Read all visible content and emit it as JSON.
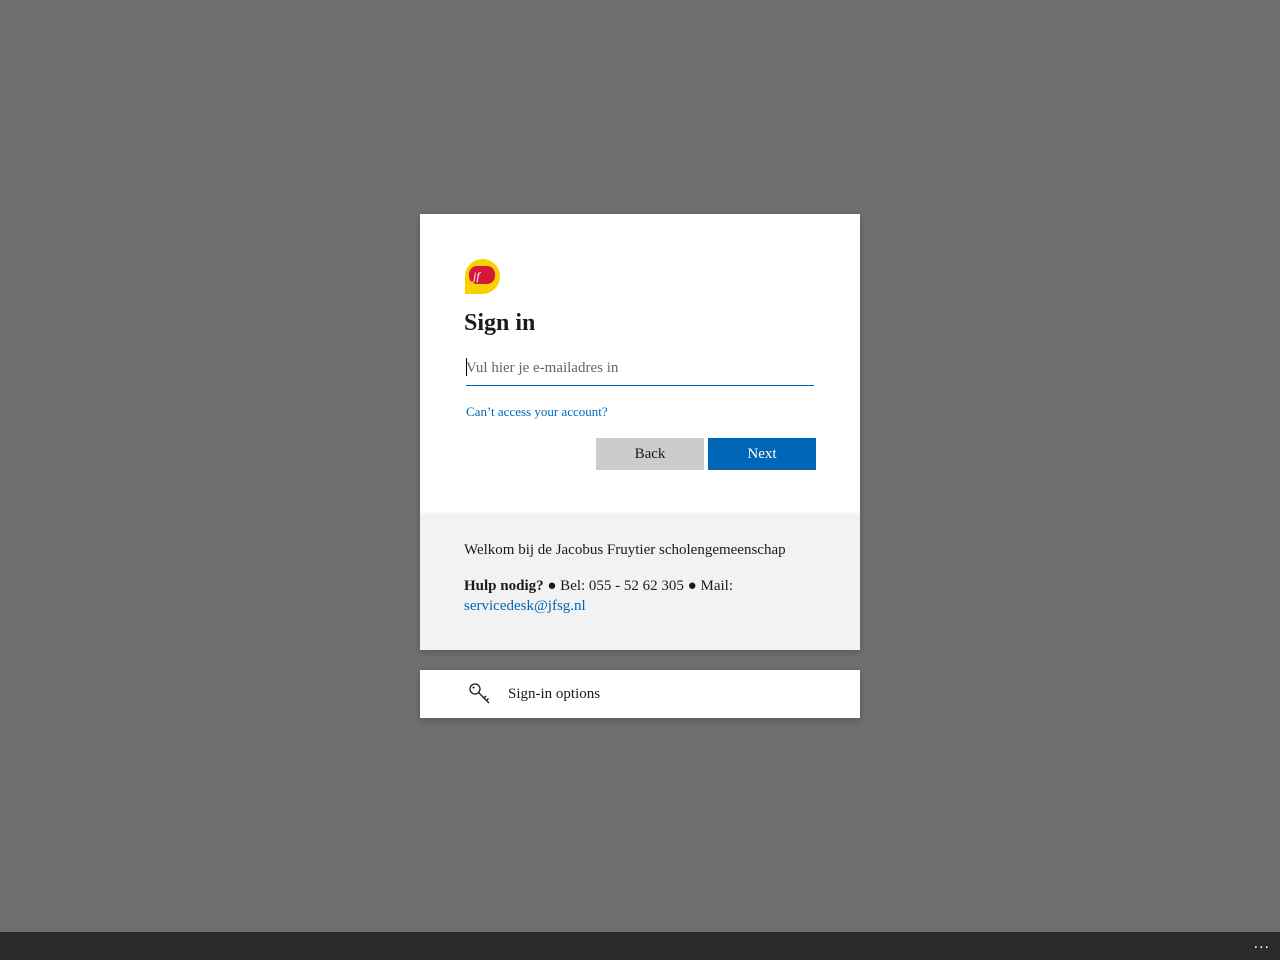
{
  "colors": {
    "background": "#6e6e6e",
    "accent": "#0067b8",
    "logo_yellow": "#f5d200",
    "logo_red": "#d6173a",
    "back_button": "#cccccc"
  },
  "signin": {
    "logo_text": "jf",
    "title": "Sign in",
    "email_placeholder": "Vul hier je e-mailadres in",
    "email_value": "",
    "cant_access_link": "Can’t access your account?",
    "back_label": "Back",
    "next_label": "Next"
  },
  "footer": {
    "welcome": "Welkom bij de Jacobus Fruytier scholengemeenschap",
    "help_bold": "Hulp nodig?",
    "help_text": " ● Bel: 055 - 52 62 305 ● Mail: ",
    "help_email": "servicedesk@jfsg.nl"
  },
  "options": {
    "icon": "key-icon",
    "label": "Sign-in options"
  },
  "bottombar": {
    "more_label": "..."
  }
}
